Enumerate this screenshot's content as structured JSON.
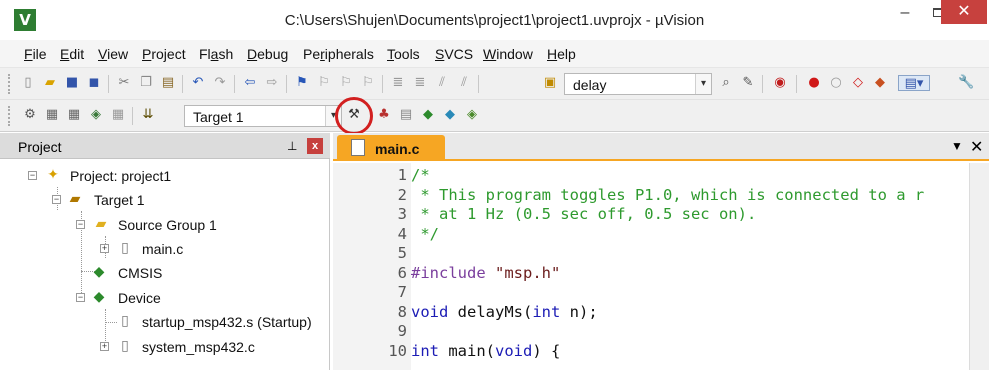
{
  "window": {
    "title": "C:\\Users\\Shujen\\Documents\\project1\\project1.uvprojx - µVision",
    "app_icon_letter": "V",
    "minimize_label": "–",
    "close_label": "✕"
  },
  "menu": {
    "items": [
      {
        "u": "F",
        "rest": "ile"
      },
      {
        "u": "E",
        "rest": "dit"
      },
      {
        "u": "V",
        "rest": "iew"
      },
      {
        "u": "P",
        "rest": "roject"
      },
      {
        "pre": "Fl",
        "u": "a",
        "rest": "sh"
      },
      {
        "u": "D",
        "rest": "ebug"
      },
      {
        "pre": "Pe",
        "u": "r",
        "rest": "ipherals"
      },
      {
        "u": "T",
        "rest": "ools"
      },
      {
        "u": "S",
        "rest": "VCS"
      },
      {
        "u": "W",
        "rest": "indow"
      },
      {
        "u": "H",
        "rest": "elp"
      }
    ]
  },
  "toolbar": {
    "find_value": "delay",
    "target_value": "Target 1"
  },
  "project_panel": {
    "title": "Project",
    "pin_glyph": "⊥",
    "close_glyph": "x",
    "tree": {
      "project": "Project: project1",
      "target": "Target 1",
      "source_group": "Source Group 1",
      "main_c": "main.c",
      "cmsis": "CMSIS",
      "device": "Device",
      "startup": "startup_msp432.s (Startup)",
      "system": "system_msp432.c"
    }
  },
  "editor": {
    "tab_label": "main.c",
    "lines": [
      {
        "n": "1",
        "parts": [
          {
            "t": "/*",
            "c": "c-comment"
          }
        ]
      },
      {
        "n": "2",
        "parts": [
          {
            "t": " * This program toggles P1.0, which is connected to a r",
            "c": "c-comment"
          }
        ]
      },
      {
        "n": "3",
        "parts": [
          {
            "t": " * at 1 Hz (0.5 sec off, 0.5 sec on).",
            "c": "c-comment"
          }
        ]
      },
      {
        "n": "4",
        "parts": [
          {
            "t": " */",
            "c": "c-comment"
          }
        ]
      },
      {
        "n": "5",
        "parts": []
      },
      {
        "n": "6",
        "parts": [
          {
            "t": "#include ",
            "c": "c-pre"
          },
          {
            "t": "\"msp.h\"",
            "c": "c-str"
          }
        ]
      },
      {
        "n": "7",
        "parts": []
      },
      {
        "n": "8",
        "parts": [
          {
            "t": "void",
            "c": "c-kw"
          },
          {
            "t": " delayMs(",
            "c": "c-plain"
          },
          {
            "t": "int",
            "c": "c-kw"
          },
          {
            "t": " n);",
            "c": "c-plain"
          }
        ]
      },
      {
        "n": "9",
        "parts": []
      },
      {
        "n": "10",
        "parts": [
          {
            "t": "int",
            "c": "c-kw"
          },
          {
            "t": " main(",
            "c": "c-plain"
          },
          {
            "t": "void",
            "c": "c-kw"
          },
          {
            "t": ") {",
            "c": "c-plain"
          }
        ]
      }
    ]
  },
  "colors": {
    "tab_active": "#f6a623",
    "close_red": "#c7413e",
    "highlight_circle": "#d21f1f",
    "comment": "#2e9a2e",
    "keyword": "#1c1cb5"
  }
}
